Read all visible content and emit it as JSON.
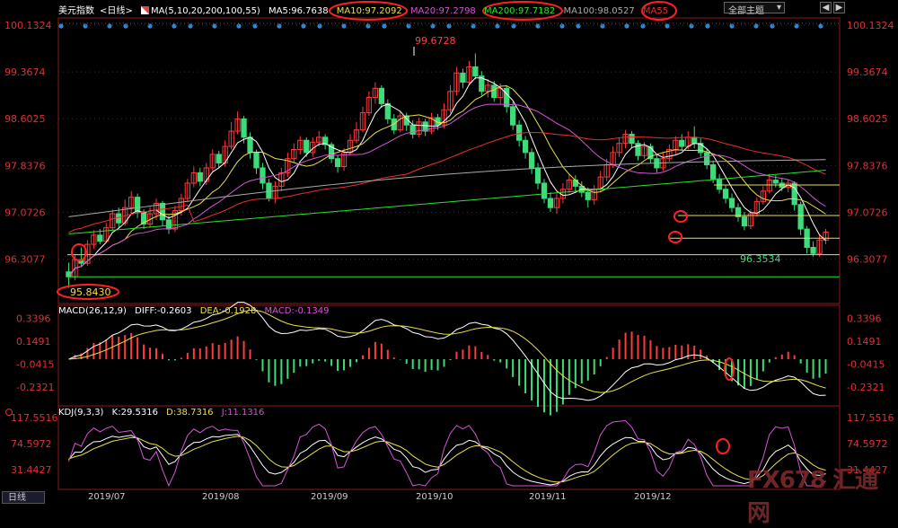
{
  "header": {
    "title": "美元指数",
    "period": "<日线>",
    "ma_params": "MA(5,10,20,200,100,55)",
    "ma5": "MA5:96.7638",
    "ma10": "MA10:97.2092",
    "ma20": "MA20:97.2798",
    "ma200": "MA200:97.7182",
    "ma100": "MA100:98.0527",
    "ma55": "MA55",
    "theme_select": "全部主题",
    "prev_btn": "◀",
    "next_btn": "▶"
  },
  "macd_header": {
    "name": "MACD(26,12,9)",
    "diff": "DIFF:-0.2603",
    "dea": "DEA:-0.1928",
    "macd": "MACD:-0.1349"
  },
  "kdj_header": {
    "name": "KDJ(9,3,3)",
    "k": "K:29.5316",
    "d": "D:38.7316",
    "j": "J:11.1316"
  },
  "period_tab": "日线",
  "watermark": "FX678 汇通网",
  "colors": {
    "up": "#ff3b3b",
    "down": "#3cdc7a",
    "ma5": "#ffffff",
    "ma10": "#e8e04a",
    "ma20": "#d455d4",
    "ma200": "#2ee02e",
    "ma100": "#aaaaaa",
    "ma55": "#e83030",
    "annotation": "#ff2020",
    "level_line": "#e8e04a"
  },
  "chart_data": {
    "type": "candlestick",
    "price_axis": {
      "min": 95.7,
      "max": 100.1324,
      "ticks": [
        "100.1324",
        "99.3674",
        "98.6025",
        "97.8376",
        "97.0726",
        "96.3077"
      ]
    },
    "x_axis_labels": [
      "2019/07",
      "2019/08",
      "2019/09",
      "2019/10",
      "2019/11",
      "2019/12"
    ],
    "annotations": {
      "high": "99.6728",
      "low": "95.8430",
      "recent_low": "96.3534"
    },
    "levels": [
      96.38,
      96.02,
      96.65,
      97.02,
      97.52
    ],
    "candles": [
      [
        96.1,
        96.02,
        96.25,
        95.84
      ],
      [
        96.02,
        96.3,
        96.38,
        95.96
      ],
      [
        96.3,
        96.24,
        96.5,
        96.18
      ],
      [
        96.24,
        96.55,
        96.62,
        96.2
      ],
      [
        96.55,
        96.7,
        96.78,
        96.48
      ],
      [
        96.7,
        96.6,
        96.8,
        96.55
      ],
      [
        96.6,
        96.82,
        96.9,
        96.58
      ],
      [
        96.82,
        97.05,
        97.12,
        96.78
      ],
      [
        97.05,
        96.9,
        97.15,
        96.82
      ],
      [
        96.9,
        97.15,
        97.28,
        96.85
      ],
      [
        97.15,
        97.32,
        97.42,
        97.05
      ],
      [
        97.32,
        97.08,
        97.38,
        96.98
      ],
      [
        97.08,
        96.88,
        97.12,
        96.8
      ],
      [
        96.88,
        97.05,
        97.16,
        96.82
      ],
      [
        97.05,
        97.22,
        97.3,
        96.95
      ],
      [
        97.22,
        96.95,
        97.26,
        96.85
      ],
      [
        96.95,
        96.8,
        97.02,
        96.72
      ],
      [
        96.8,
        97.1,
        97.18,
        96.75
      ],
      [
        97.1,
        97.3,
        97.38,
        97.02
      ],
      [
        97.3,
        97.55,
        97.62,
        97.25
      ],
      [
        97.55,
        97.72,
        97.82,
        97.48
      ],
      [
        97.72,
        97.58,
        97.8,
        97.5
      ],
      [
        97.58,
        97.8,
        97.88,
        97.52
      ],
      [
        97.8,
        98.02,
        98.1,
        97.75
      ],
      [
        98.02,
        97.88,
        98.08,
        97.8
      ],
      [
        97.88,
        98.15,
        98.25,
        97.82
      ],
      [
        98.15,
        98.4,
        98.55,
        98.1
      ],
      [
        98.4,
        98.6,
        98.72,
        98.35
      ],
      [
        98.6,
        98.3,
        98.65,
        98.2
      ],
      [
        98.3,
        98.05,
        98.38,
        97.95
      ],
      [
        98.05,
        97.8,
        98.1,
        97.7
      ],
      [
        97.8,
        97.55,
        97.88,
        97.45
      ],
      [
        97.55,
        97.3,
        97.62,
        97.25
      ],
      [
        97.3,
        97.5,
        97.58,
        97.22
      ],
      [
        97.5,
        97.72,
        97.8,
        97.42
      ],
      [
        97.72,
        97.95,
        98.05,
        97.65
      ],
      [
        97.95,
        98.1,
        98.2,
        97.88
      ],
      [
        98.1,
        98.25,
        98.32,
        98.02
      ],
      [
        98.25,
        98.05,
        98.3,
        97.98
      ],
      [
        98.05,
        98.22,
        98.3,
        97.98
      ],
      [
        98.22,
        98.3,
        98.4,
        98.15
      ],
      [
        98.3,
        98.18,
        98.35,
        98.1
      ],
      [
        98.18,
        97.95,
        98.22,
        97.88
      ],
      [
        97.95,
        97.82,
        98.0,
        97.72
      ],
      [
        97.82,
        98.05,
        98.12,
        97.75
      ],
      [
        98.05,
        98.25,
        98.35,
        98.0
      ],
      [
        98.25,
        98.42,
        98.55,
        98.2
      ],
      [
        98.42,
        98.7,
        98.8,
        98.38
      ],
      [
        98.7,
        98.95,
        99.05,
        98.65
      ],
      [
        98.95,
        99.1,
        99.2,
        98.85
      ],
      [
        99.1,
        98.85,
        99.15,
        98.78
      ],
      [
        98.85,
        98.6,
        98.92,
        98.52
      ],
      [
        98.6,
        98.42,
        98.68,
        98.35
      ],
      [
        98.42,
        98.65,
        98.72,
        98.38
      ],
      [
        98.65,
        98.5,
        98.7,
        98.4
      ],
      [
        98.5,
        98.35,
        98.58,
        98.28
      ],
      [
        98.35,
        98.55,
        98.62,
        98.3
      ],
      [
        98.55,
        98.4,
        98.6,
        98.32
      ],
      [
        98.4,
        98.62,
        98.7,
        98.35
      ],
      [
        98.62,
        98.5,
        98.68,
        98.42
      ],
      [
        98.5,
        98.75,
        98.85,
        98.45
      ],
      [
        98.75,
        99.05,
        99.15,
        98.7
      ],
      [
        99.05,
        99.35,
        99.45,
        98.98
      ],
      [
        99.35,
        99.2,
        99.42,
        99.1
      ],
      [
        99.2,
        99.45,
        99.55,
        99.15
      ],
      [
        99.45,
        99.3,
        99.67,
        99.25
      ],
      [
        99.3,
        99.05,
        99.38,
        98.98
      ],
      [
        99.05,
        99.15,
        99.25,
        98.95
      ],
      [
        99.15,
        98.95,
        99.22,
        98.88
      ],
      [
        98.95,
        99.1,
        99.18,
        98.85
      ],
      [
        99.1,
        98.8,
        99.15,
        98.7
      ],
      [
        98.8,
        98.5,
        98.88,
        98.42
      ],
      [
        98.5,
        98.25,
        98.58,
        98.15
      ],
      [
        98.25,
        98.05,
        98.32,
        97.95
      ],
      [
        98.05,
        97.8,
        98.12,
        97.7
      ],
      [
        97.8,
        97.55,
        97.88,
        97.45
      ],
      [
        97.55,
        97.3,
        97.62,
        97.22
      ],
      [
        97.3,
        97.15,
        97.4,
        97.08
      ],
      [
        97.15,
        97.3,
        97.38,
        97.05
      ],
      [
        97.3,
        97.45,
        97.55,
        97.22
      ],
      [
        97.45,
        97.6,
        97.7,
        97.38
      ],
      [
        97.6,
        97.5,
        97.68,
        97.4
      ],
      [
        97.5,
        97.4,
        97.58,
        97.32
      ],
      [
        97.4,
        97.28,
        97.48,
        97.15
      ],
      [
        97.28,
        97.45,
        97.52,
        97.2
      ],
      [
        97.45,
        97.65,
        97.75,
        97.4
      ],
      [
        97.65,
        97.85,
        97.95,
        97.58
      ],
      [
        97.85,
        98.05,
        98.15,
        97.8
      ],
      [
        98.05,
        98.2,
        98.3,
        97.98
      ],
      [
        98.2,
        98.35,
        98.42,
        98.12
      ],
      [
        98.35,
        98.2,
        98.4,
        98.12
      ],
      [
        98.2,
        98.0,
        98.25,
        97.92
      ],
      [
        98.0,
        98.15,
        98.22,
        97.95
      ],
      [
        98.15,
        97.95,
        98.2,
        97.88
      ],
      [
        97.95,
        97.8,
        98.02,
        97.72
      ],
      [
        97.8,
        97.95,
        98.05,
        97.75
      ],
      [
        97.95,
        98.1,
        98.18,
        97.9
      ],
      [
        98.1,
        98.25,
        98.32,
        98.02
      ],
      [
        98.25,
        98.15,
        98.35,
        98.08
      ],
      [
        98.15,
        98.3,
        98.4,
        98.1
      ],
      [
        98.3,
        98.2,
        98.48,
        98.12
      ],
      [
        98.2,
        98.05,
        98.28,
        97.98
      ],
      [
        98.05,
        97.85,
        98.12,
        97.78
      ],
      [
        97.85,
        97.62,
        97.92,
        97.55
      ],
      [
        97.62,
        97.45,
        97.7,
        97.38
      ],
      [
        97.45,
        97.3,
        97.52,
        97.22
      ],
      [
        97.3,
        97.15,
        97.38,
        97.08
      ],
      [
        97.15,
        97.0,
        97.22,
        96.92
      ],
      [
        97.0,
        96.85,
        97.08,
        96.78
      ],
      [
        96.85,
        97.05,
        97.12,
        96.8
      ],
      [
        97.05,
        97.25,
        97.32,
        97.0
      ],
      [
        97.25,
        97.42,
        97.5,
        97.2
      ],
      [
        97.42,
        97.6,
        97.7,
        97.38
      ],
      [
        97.6,
        97.55,
        97.68,
        97.48
      ],
      [
        97.55,
        97.48,
        97.62,
        97.42
      ],
      [
        97.48,
        97.55,
        97.6,
        97.4
      ],
      [
        97.55,
        97.2,
        97.58,
        97.1
      ],
      [
        97.2,
        96.8,
        97.25,
        96.7
      ],
      [
        96.8,
        96.5,
        96.85,
        96.4
      ],
      [
        96.5,
        96.4,
        96.6,
        96.35
      ],
      [
        96.4,
        96.62,
        96.7,
        96.35
      ],
      [
        96.62,
        96.75,
        96.8,
        96.55
      ]
    ],
    "macd_axis": {
      "min": -0.33,
      "max": 0.39,
      "ticks": [
        "0.3396",
        "0.1491",
        "-0.0415",
        "-0.2321"
      ]
    },
    "kdj_axis": {
      "min": 5,
      "max": 125,
      "ticks": [
        "117.5516",
        "74.5972",
        "31.4427"
      ]
    }
  }
}
